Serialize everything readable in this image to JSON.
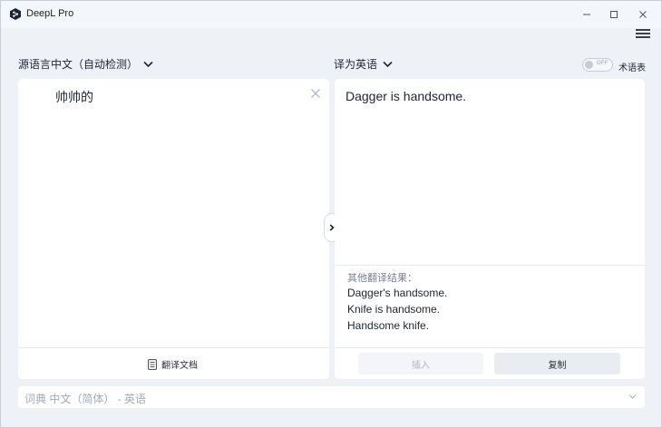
{
  "app": {
    "title": "DeepL Pro"
  },
  "window_controls": {
    "minimize": "—",
    "maximize": "☐",
    "close": "✕"
  },
  "source": {
    "language_label": "源语言中文（自动检测）",
    "text": "帅帅的",
    "translate_document_label": "翻译文档"
  },
  "target": {
    "language_label": "译为英语",
    "text": "Dagger is handsome.",
    "alternatives_heading": "其他翻译结果：",
    "alternatives": [
      "Dagger's handsome.",
      "Knife is handsome.",
      "Handsome knife."
    ],
    "insert_label": "插入",
    "copy_label": "复制"
  },
  "glossary": {
    "toggle_state": "OFF",
    "label": "术语表"
  },
  "dictionary": {
    "label": "词典 中文（简体） - 英语"
  },
  "colors": {
    "background": "#eef2f7",
    "panel": "#ffffff",
    "text": "#1f2430",
    "muted": "#a3aab4"
  }
}
